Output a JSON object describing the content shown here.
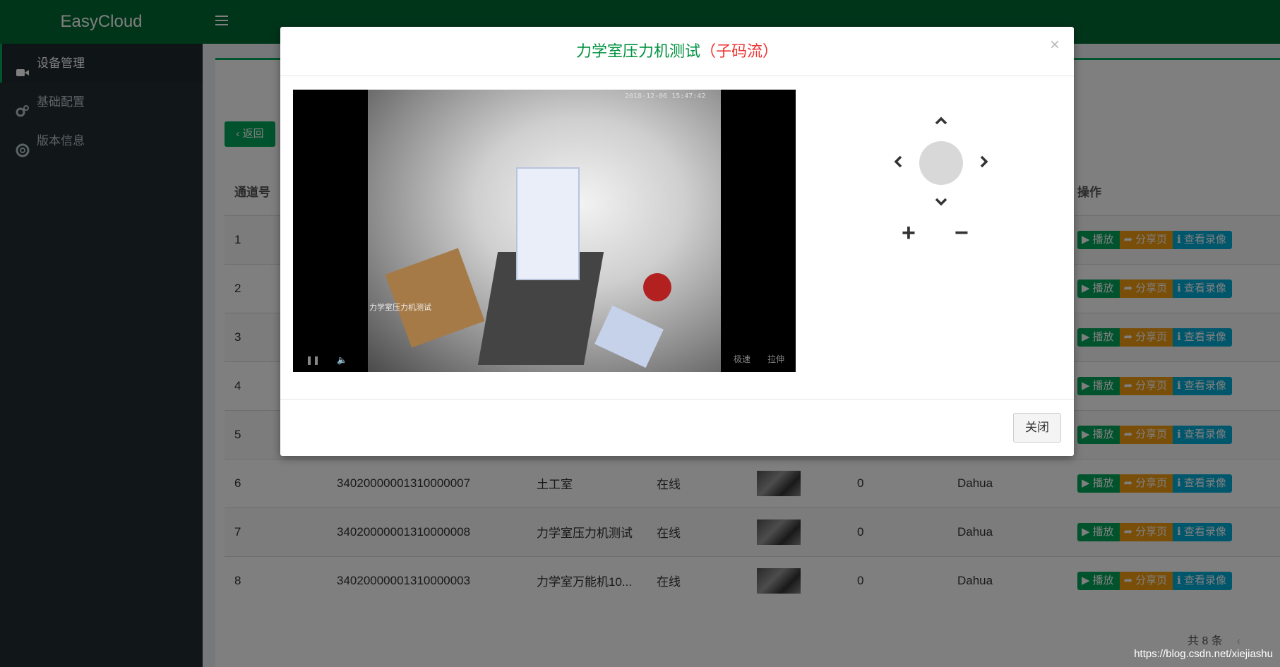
{
  "app": {
    "title": "EasyCloud"
  },
  "sidebar": {
    "items": [
      {
        "label": "设备管理",
        "icon": "video-camera-icon",
        "active": true
      },
      {
        "label": "基础配置",
        "icon": "gears-icon",
        "active": false
      },
      {
        "label": "版本信息",
        "icon": "life-ring-icon",
        "active": false
      }
    ]
  },
  "toolbar": {
    "back_label": "返回"
  },
  "table": {
    "headers": {
      "channel": "通道号",
      "ops": "操作"
    },
    "rows": [
      {
        "no": "1"
      },
      {
        "no": "2"
      },
      {
        "no": "3"
      },
      {
        "no": "4"
      },
      {
        "no": "5"
      },
      {
        "no": "6",
        "id": "34020000001310000007",
        "name": "土工室",
        "status": "在线",
        "count": "0",
        "vendor": "Dahua"
      },
      {
        "no": "7",
        "id": "34020000001310000008",
        "name": "力学室压力机测试",
        "status": "在线",
        "count": "0",
        "vendor": "Dahua"
      },
      {
        "no": "8",
        "id": "34020000001310000003",
        "name": "力学室万能机10...",
        "status": "在线",
        "count": "0",
        "vendor": "Dahua"
      }
    ],
    "ops": {
      "play": "播放",
      "share": "分享页",
      "record": "查看录像"
    }
  },
  "pager": {
    "total": "共 8 条"
  },
  "modal": {
    "title": "力学室压力机测试",
    "subtitle": "（子码流）",
    "close_x": "×",
    "close_button": "关闭",
    "video": {
      "timestamp": "2018-12-06 15:47:42",
      "osd_label": "力学室压力机测试",
      "ctrl_speed": "极速",
      "ctrl_stretch": "拉伸"
    },
    "ptz": {
      "zoom_in": "+",
      "zoom_out": "−"
    }
  },
  "watermark": "https://blog.csdn.net/xiejiashu",
  "colors": {
    "header": "#006b35",
    "sidebar": "#222d32",
    "play": "#00a65a",
    "share": "#f39c12",
    "record": "#00acd6",
    "title": "#00923f",
    "subtitle": "#e33333"
  }
}
